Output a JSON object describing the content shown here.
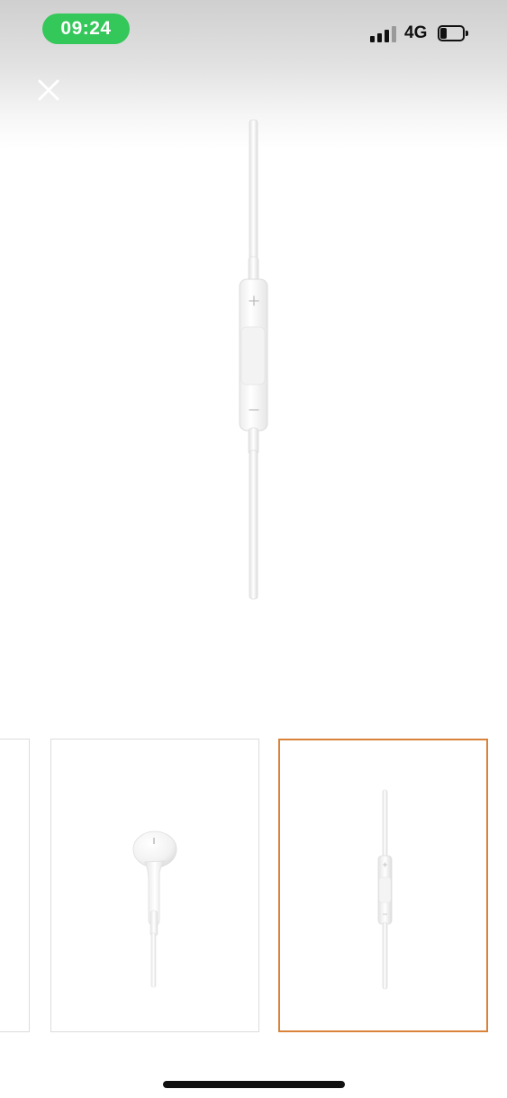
{
  "status_bar": {
    "time": "09:24",
    "network": "4G",
    "signal_bars_active": 3,
    "signal_bars_total": 4,
    "battery_level": 0.3,
    "time_pill_color": "#34c759"
  },
  "toolbar": {
    "close_icon": "close-icon"
  },
  "gallery": {
    "main_image": "earpods-remote-cable-image",
    "selected_index": 2,
    "thumbnails": [
      {
        "image": "earpods-partial-image",
        "selected": false
      },
      {
        "image": "earpod-earbud-image",
        "selected": false
      },
      {
        "image": "earpods-remote-cable-image",
        "selected": true
      }
    ],
    "selected_border_color": "#d9823a"
  }
}
